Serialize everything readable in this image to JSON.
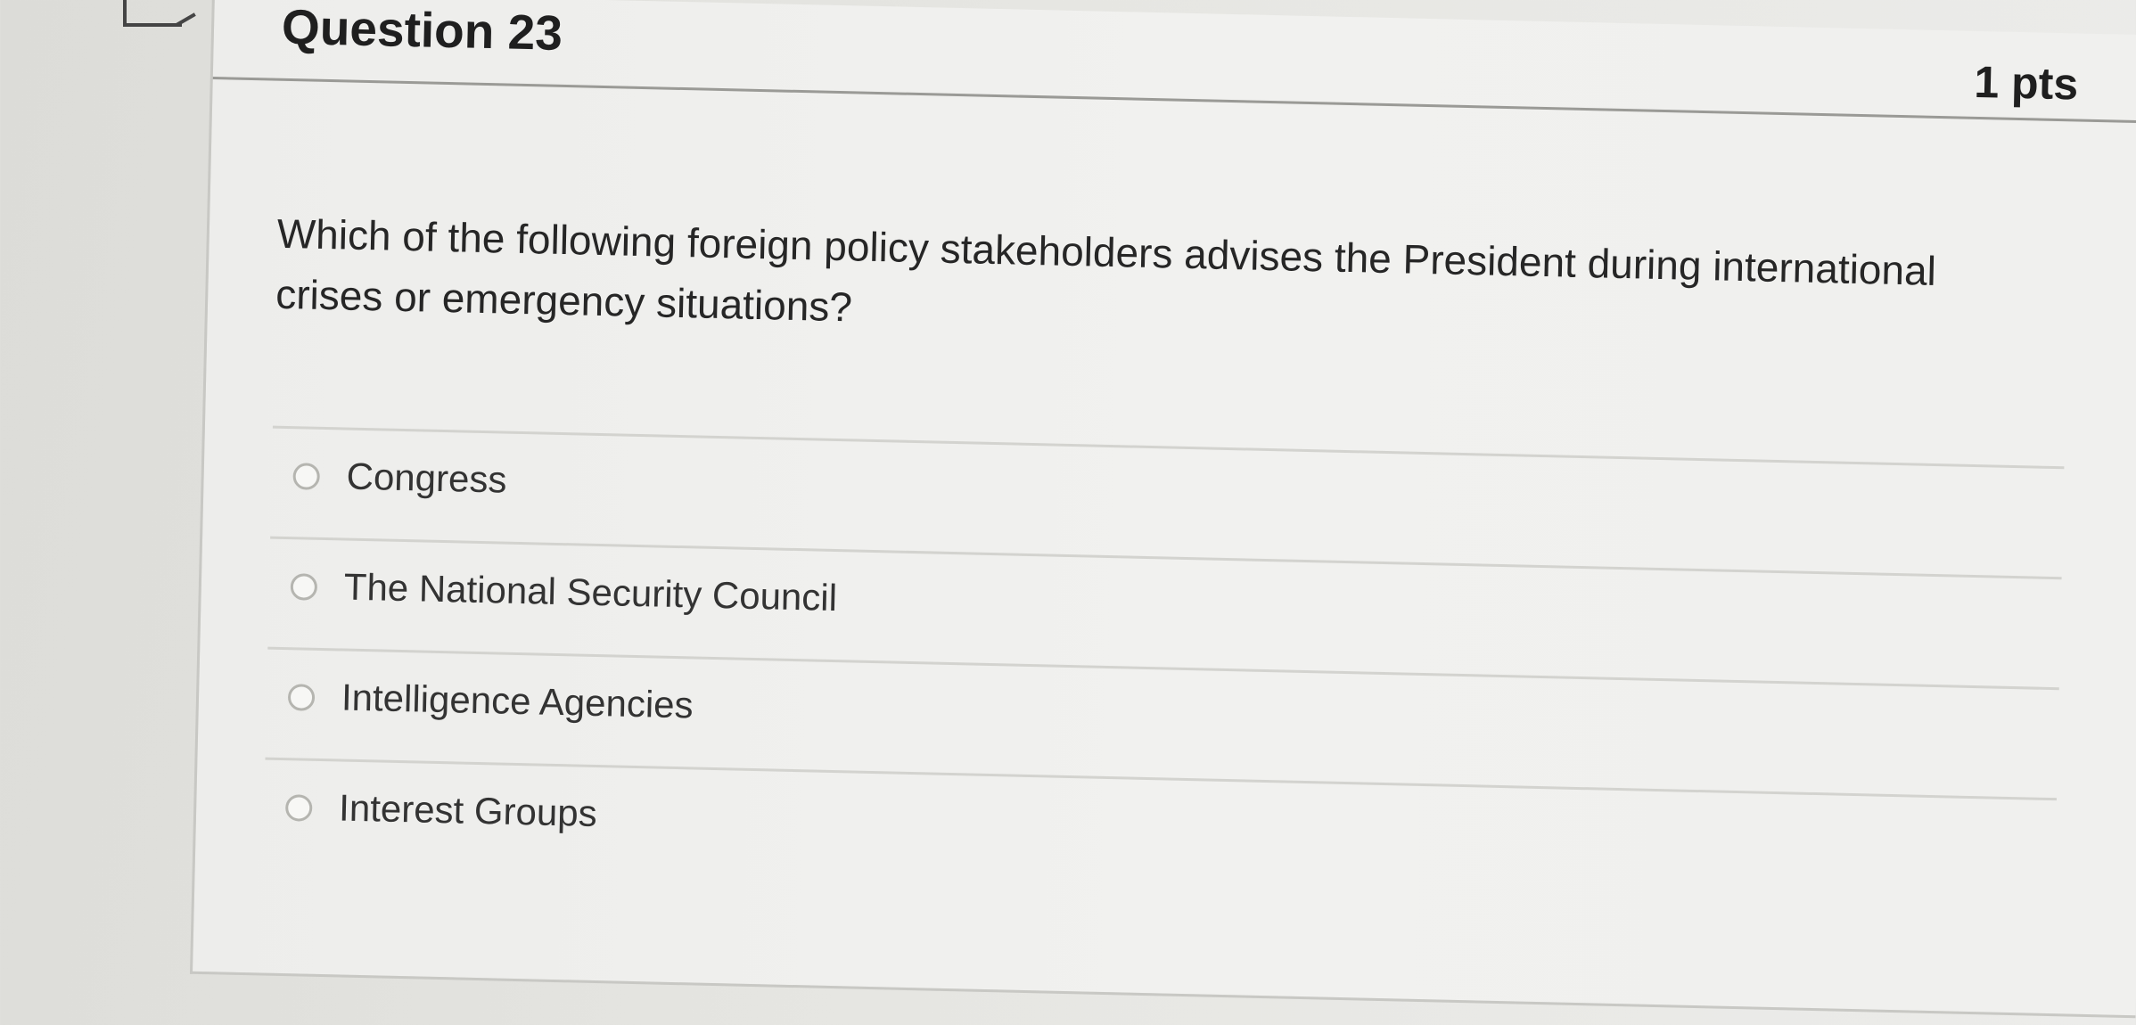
{
  "question": {
    "title": "Question 23",
    "points": "1 pts",
    "text": "Which of the following foreign policy stakeholders advises the President during international crises or emergency situations?",
    "answers": [
      {
        "label": "Congress"
      },
      {
        "label": "The National Security Council"
      },
      {
        "label": "Intelligence Agencies"
      },
      {
        "label": "Interest Groups"
      }
    ]
  }
}
